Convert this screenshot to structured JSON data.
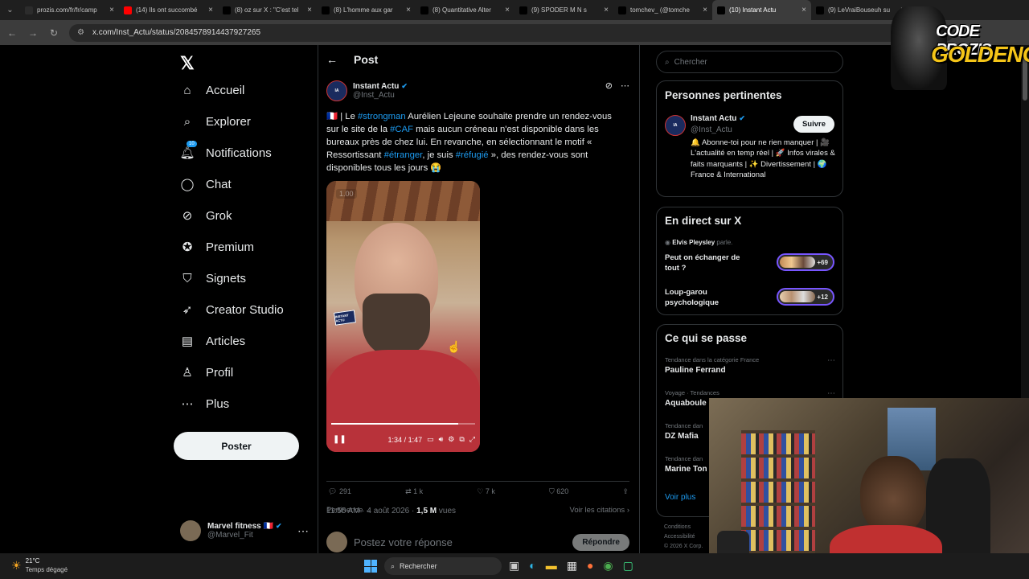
{
  "browser": {
    "tabs": [
      {
        "title": "prozis.com/fr/fr/camp",
        "icon": "prozis-favicon",
        "color": "#2c2c2c"
      },
      {
        "title": "(14) Ils ont succombé",
        "icon": "youtube-favicon",
        "color": "#ff0000"
      },
      {
        "title": "(8) oz sur X : \"C'est tel",
        "icon": "x-favicon",
        "color": "#000000"
      },
      {
        "title": "(8) L'homme aux gar",
        "icon": "x-favicon",
        "color": "#000000"
      },
      {
        "title": "(8) Quantitative Alter",
        "icon": "x-favicon",
        "color": "#000000"
      },
      {
        "title": "(9) SPODER M N s",
        "icon": "x-favicon",
        "color": "#000000"
      },
      {
        "title": "tomchev_ (@tomche",
        "icon": "tiktok-favicon",
        "color": "#000000"
      },
      {
        "title": "(10) Instant Actu",
        "icon": "x-favicon",
        "color": "#000000",
        "active": true
      },
      {
        "title": "(9) LeVraiBouseuh su",
        "icon": "x-favicon",
        "color": "#000000"
      }
    ],
    "url": "x.com/Inst_Actu/status/2084578914437927265"
  },
  "nav": {
    "logo": "𝕏",
    "items": [
      {
        "label": "Accueil",
        "icon": "home-icon",
        "glyph": "⌂"
      },
      {
        "label": "Explorer",
        "icon": "search-icon",
        "glyph": "⌕"
      },
      {
        "label": "Notifications",
        "icon": "bell-icon",
        "glyph": "🔔︎",
        "badge": "10"
      },
      {
        "label": "Chat",
        "icon": "chat-icon",
        "glyph": "◯"
      },
      {
        "label": "Grok",
        "icon": "grok-icon",
        "glyph": "⊘"
      },
      {
        "label": "Premium",
        "icon": "premium-icon",
        "glyph": "✪"
      },
      {
        "label": "Signets",
        "icon": "bookmark-icon",
        "glyph": "⛉"
      },
      {
        "label": "Creator Studio",
        "icon": "rocket-icon",
        "glyph": "➶"
      },
      {
        "label": "Articles",
        "icon": "articles-icon",
        "glyph": "▤"
      },
      {
        "label": "Profil",
        "icon": "profile-icon",
        "glyph": "♙"
      },
      {
        "label": "Plus",
        "icon": "more-icon",
        "glyph": "⋯"
      }
    ],
    "post_button": "Poster",
    "account": {
      "name": "Marvel fitness 🇫🇷",
      "handle": "@Marvel_Fit"
    }
  },
  "post": {
    "header_title": "Post",
    "author_name": "Instant Actu",
    "author_handle": "@Inst_Actu",
    "text_parts": {
      "flag": "🇫🇷",
      "p1": " | Le ",
      "h1": "#strongman",
      "p2": " Aurélien Lejeune souhaite prendre un rendez-vous sur le site de la ",
      "h2": "#CAF",
      "p3": " mais aucun créneau n'est disponible dans les bureaux près de chez lui. En revanche, en sélectionnant le motif « Ressortissant ",
      "h3": "#étranger",
      "p4": ", je suis ",
      "h4": "#réfugié",
      "p5": " », des rendez-vous sont disponibles tous les jours 😭"
    },
    "video": {
      "speed": "1.00",
      "time": "1:34 / 1:47",
      "progress": 0.88,
      "watermark": "INSTANT ACTU"
    },
    "timestamp": "11:55 AM · 4 août 2026 · ",
    "views_count": "1,5 M",
    "views_label": " vues",
    "stats": {
      "replies": "291",
      "reposts": "1 k",
      "likes": "7 k",
      "bookmarks": "620"
    },
    "pertinence": "Pertinence",
    "citations": "Voir les citations",
    "reply_placeholder": "Postez votre réponse",
    "reply_button": "Répondre"
  },
  "sidebar": {
    "search_placeholder": "Chercher",
    "relevant": {
      "title": "Personnes pertinentes",
      "name": "Instant Actu",
      "handle": "@Inst_Actu",
      "follow": "Suivre",
      "bio": "🔔 Abonne-toi pour ne rien manquer | 🎥 L'actualité en temp réel | 🚀 Infos virales & faits marquants | ✨ Divertissement | 🌍 France & International"
    },
    "live": {
      "title": "En direct sur X",
      "host": "Elvis Pleysley",
      "host_suffix": " parle.",
      "spaces": [
        {
          "title": "Peut on échanger de tout ?",
          "count": "+69"
        },
        {
          "title": "Loup-garou psychologique",
          "count": "+12"
        }
      ]
    },
    "trends": {
      "title": "Ce qui se passe",
      "items": [
        {
          "context": "Tendance dans la catégorie France",
          "name": "Pauline Ferrand"
        },
        {
          "context": "Voyage · Tendances",
          "name": "Aquaboule"
        },
        {
          "context": "Tendance dan",
          "name": "DZ Mafia"
        },
        {
          "context": "Tendance dan",
          "name": "Marine Ton"
        }
      ],
      "more": "Voir plus"
    },
    "footer": [
      "Conditions",
      "Accessibilité",
      "© 2026 X Corp."
    ]
  },
  "overlay": {
    "line1": "CODE PROZIS",
    "line2": "GOLDENG"
  },
  "taskbar": {
    "temp": "21°C",
    "weather": "Temps dégagé",
    "search_placeholder": "Rechercher"
  },
  "colors": {
    "accent": "#1d9bf0",
    "background": "#000000",
    "gold": "#f5c518"
  }
}
